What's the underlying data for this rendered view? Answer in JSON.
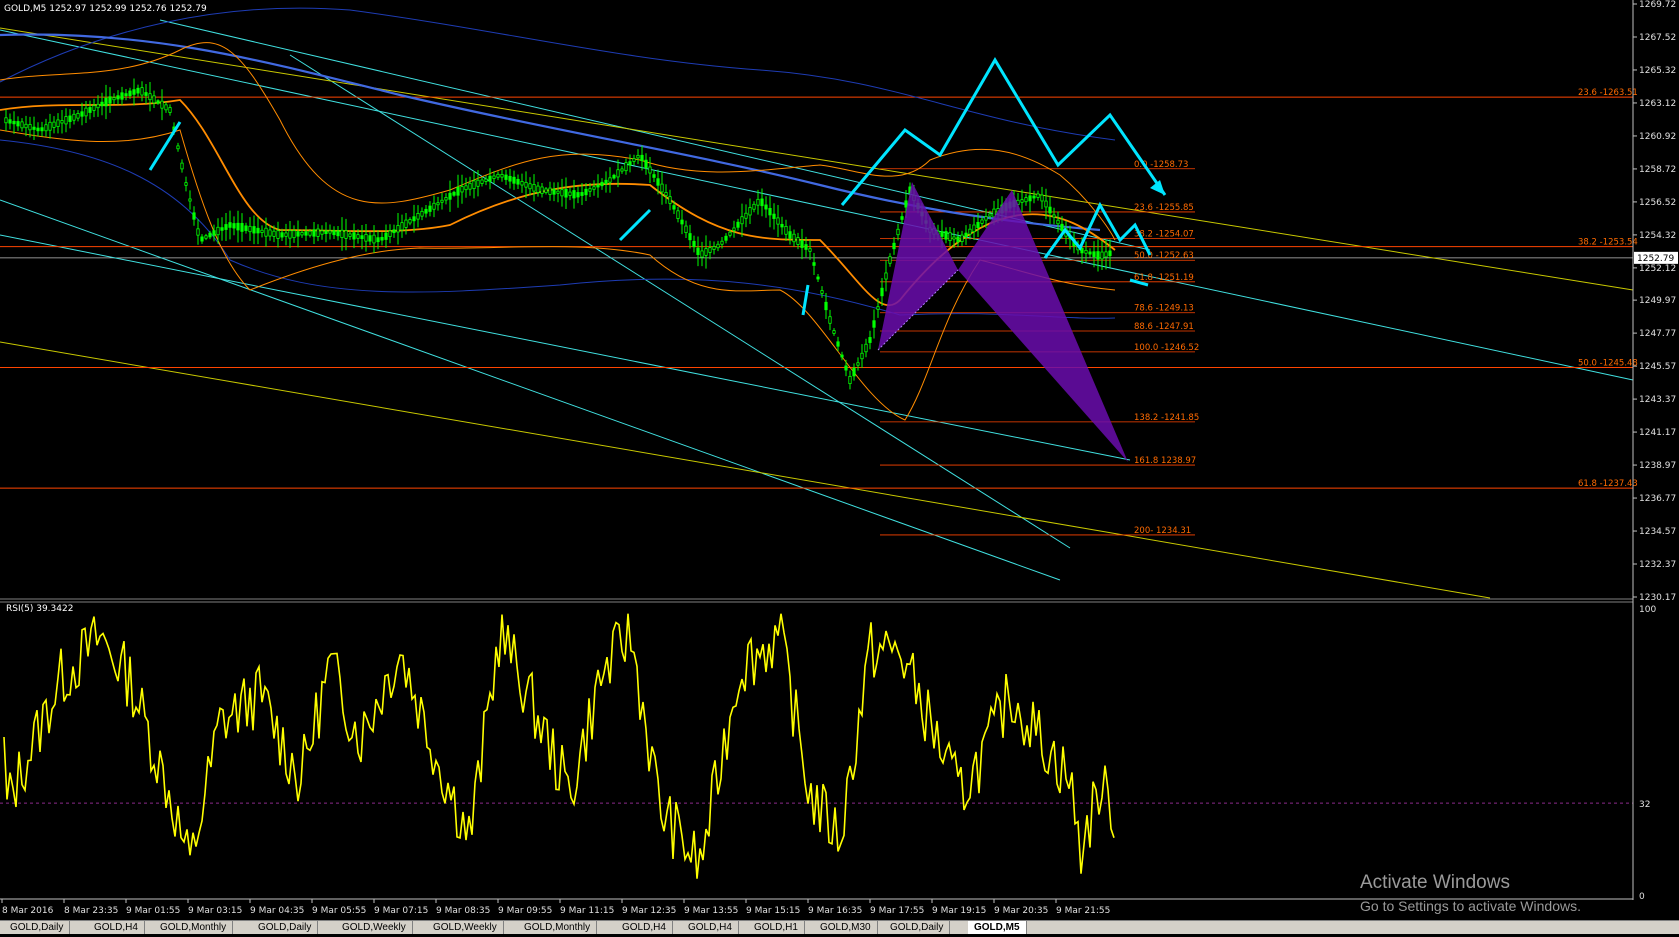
{
  "window": {
    "symbol_header": "GOLD,M5  1252.97 1252.99 1252.76 1252.79",
    "rsi_header": "RSI(5) 39.3422"
  },
  "price_axis": {
    "labels": [
      "1269.72",
      "1267.52",
      "1265.32",
      "1263.12",
      "1260.92",
      "1258.72",
      "1256.52",
      "1254.32",
      "1252.12",
      "1249.97",
      "1247.77",
      "1245.57",
      "1243.37",
      "1241.17",
      "1238.97",
      "1236.77",
      "1234.57",
      "1232.37",
      "1230.17"
    ],
    "current_price": "1252.79"
  },
  "rsi_axis": {
    "labels": [
      "100",
      "32",
      "0"
    ]
  },
  "time_axis": {
    "labels": [
      "8 Mar 2016",
      "8 Mar 23:35",
      "9 Mar 01:55",
      "9 Mar 03:15",
      "9 Mar 04:35",
      "9 Mar 05:55",
      "9 Mar 07:15",
      "9 Mar 08:35",
      "9 Mar 09:55",
      "9 Mar 11:15",
      "9 Mar 12:35",
      "9 Mar 13:55",
      "9 Mar 15:15",
      "9 Mar 16:35",
      "9 Mar 17:55",
      "9 Mar 19:15",
      "9 Mar 20:35",
      "9 Mar 21:55"
    ]
  },
  "fib_right": [
    {
      "label": "23.6 -1263.51",
      "price": 1263.51
    },
    {
      "label": "38.2 -1253.54",
      "price": 1253.54
    },
    {
      "label": "50.0 -1245.48",
      "price": 1245.48
    },
    {
      "label": "61.8 -1237.43",
      "price": 1237.43
    }
  ],
  "fib_mid": [
    {
      "label": "0.0 -1258.73",
      "price": 1258.73
    },
    {
      "label": "23.6 -1255.85",
      "price": 1255.85
    },
    {
      "label": "38.2 -1254.07",
      "price": 1254.07
    },
    {
      "label": "50.0 -1252.63",
      "price": 1252.63
    },
    {
      "label": "61.8 -1251.19",
      "price": 1251.19
    },
    {
      "label": "78.6 -1249.13",
      "price": 1249.13
    },
    {
      "label": "88.6 -1247.91",
      "price": 1247.91
    },
    {
      "label": "100.0 -1246.52",
      "price": 1246.52
    },
    {
      "label": "138.2 -1241.85",
      "price": 1241.85
    },
    {
      "label": "161.8 1238.97",
      "price": 1238.97
    },
    {
      "label": "200- 1234.31",
      "price": 1234.31
    }
  ],
  "tabs": [
    "GOLD,Daily",
    "GOLD,H4",
    "GOLD,Monthly",
    "GOLD,Daily",
    "GOLD,Weekly",
    "GOLD,Weekly",
    "GOLD,Monthly",
    "GOLD,H4",
    "GOLD,H4",
    "GOLD,H1",
    "GOLD,M30",
    "GOLD,Daily",
    "GOLD,M5"
  ],
  "active_tab": "GOLD,M5",
  "watermark": {
    "line1": "Activate Windows",
    "line2": "Go to Settings to activate Windows."
  },
  "colors": {
    "candles": "#00ff00",
    "fib_lines": "#ff4500",
    "fib_text": "#ff6a00",
    "trend_cyan": "#40e0e0",
    "trend_yellow": "#c8c800",
    "ma_orange": "#ff8c00",
    "ma_blue": "#4169e1",
    "bands_blue": "#1e3cb4",
    "pattern": "#6a0dad",
    "arrows": "#00e5ff",
    "rsi": "#ffff00"
  }
}
